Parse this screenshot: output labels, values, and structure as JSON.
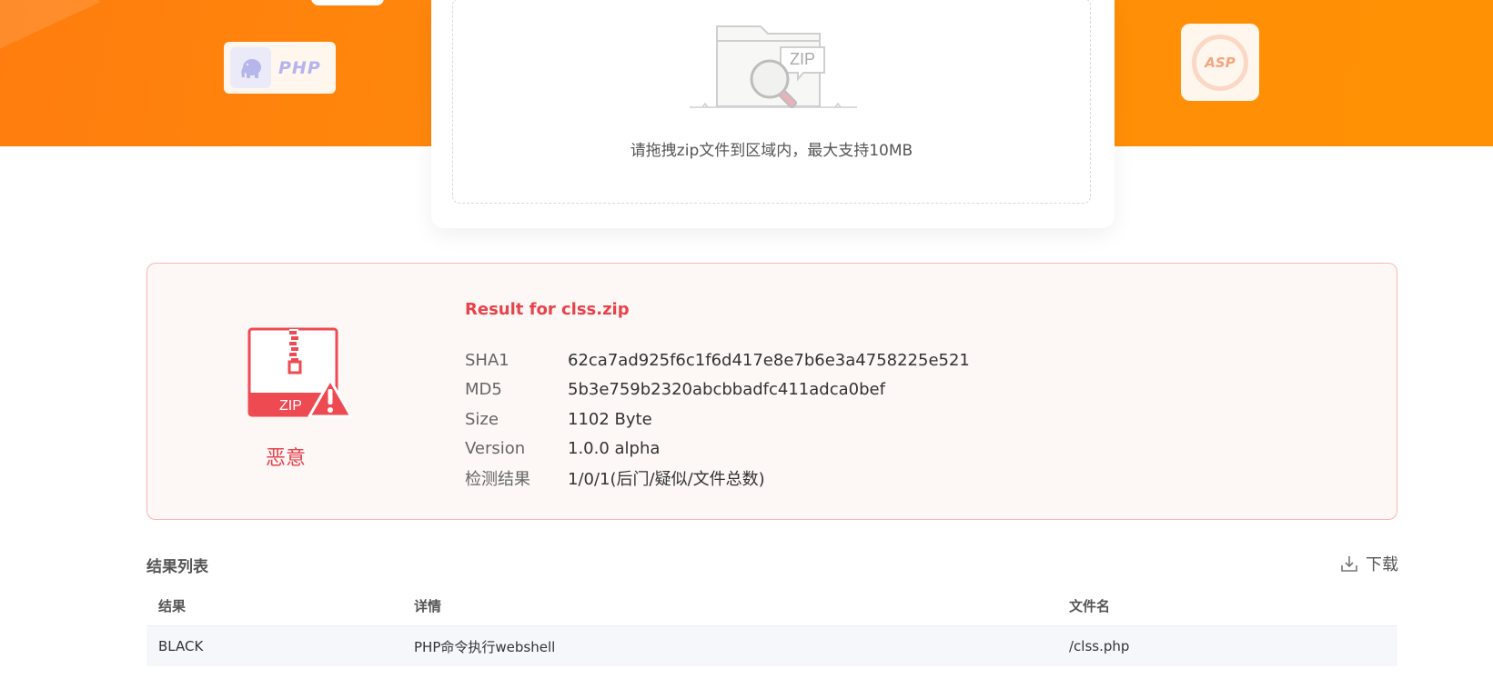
{
  "hero": {
    "php_label": "PHP",
    "asp_label": "ASP",
    "brand_color": "#ff8a0b"
  },
  "upload": {
    "zip_badge": "ZIP",
    "hint": "请拖拽zip文件到区域内，最大支持10MB"
  },
  "result": {
    "zip_label": "ZIP",
    "verdict": "恶意",
    "title": "Result for clss.zip",
    "accent_color": "#e8424b",
    "rows": [
      {
        "key": "SHA1",
        "value": "62ca7ad925f6c1f6d417e8e7b6e3a4758225e521"
      },
      {
        "key": "MD5",
        "value": "5b3e759b2320abcbbadfc411adca0bef"
      },
      {
        "key": "Size",
        "value": "1102 Byte"
      },
      {
        "key": "Version",
        "value": "1.0.0 alpha"
      },
      {
        "key": "检测结果",
        "value": "1/0/1(后门/疑似/文件总数)"
      }
    ]
  },
  "list": {
    "title": "结果列表",
    "download_label": "下载",
    "columns": [
      "结果",
      "详情",
      "文件名"
    ],
    "rows": [
      {
        "result": "BLACK",
        "detail": "PHP命令执行webshell",
        "filename": "/clss.php"
      }
    ]
  }
}
